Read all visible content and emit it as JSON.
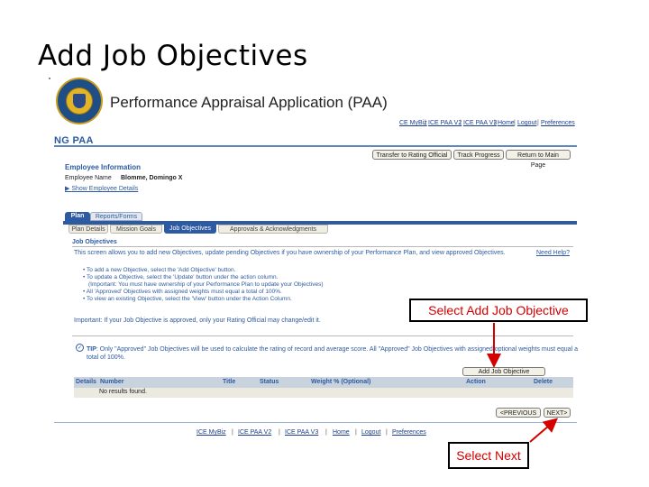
{
  "slide": {
    "title": "Add Job Objectives"
  },
  "app": {
    "title": "Performance Appraisal Application (PAA)",
    "top_links": [
      "CE MyBiz",
      "ICE PAA V2",
      "ICE PAA V3",
      "Home",
      "Logout",
      "Preferences"
    ],
    "section_label": "NG PAA"
  },
  "header_buttons": [
    "Transfer to Rating Official",
    "Track Progress",
    "Return to Main Page"
  ],
  "employee": {
    "heading": "Employee Information",
    "name_label": "Employee Name",
    "name_value": "Blomme, Domingo X",
    "show_details": "Show Employee Details"
  },
  "tabs": [
    "Plan",
    "Reports/Forms"
  ],
  "subtabs": [
    "Plan Details",
    "Mission Goals",
    "Job Objectives",
    "Approvals & Acknowledgments"
  ],
  "content": {
    "heading": "Job Objectives",
    "intro": "This screen allows you to add new Objectives, update pending Objectives if you have ownership of your Performance Plan, and view approved Objectives.",
    "need_help": "Need Help?",
    "bullets": [
      "To add a new Objective, select the 'Add Objective' button.",
      "To update a Objective, select the 'Update' button under the action column.",
      "(Important: You must have ownership of your Performance Plan to update your Objectives)",
      "All 'Approved' Objectives with assigned weights must equal a total of 100%.",
      "To view an existing Objective, select the 'View' button under the Action Column."
    ],
    "important": "Important: If your Job Objective is approved, only your Rating Official may change/edit it.",
    "tip_prefix": "TIP",
    "tip": "Only \"Approved\" Job Objectives will be used to calculate the rating of record and average score. All \"Approved\" Job Objectives with assigned optional weights must equal a total of 100%."
  },
  "table": {
    "add_button": "Add Job Objective",
    "headers": [
      "Details",
      "Number",
      "Title",
      "Status",
      "Weight % (Optional)",
      "Action",
      "Delete"
    ],
    "empty_text": "No results found."
  },
  "nav": {
    "previous": "<PREVIOUS",
    "next": "NEXT>"
  },
  "footer_links": [
    "ICE MyBiz",
    "ICE PAA V2",
    "ICE PAA V3",
    "Home",
    "Logout",
    "Preferences"
  ],
  "callouts": {
    "add": "Select Add Job Objective",
    "next": "Select Next"
  },
  "colors": {
    "accent": "#2d5aa0",
    "callout_text": "#d40000",
    "arrow": "#d40000"
  }
}
